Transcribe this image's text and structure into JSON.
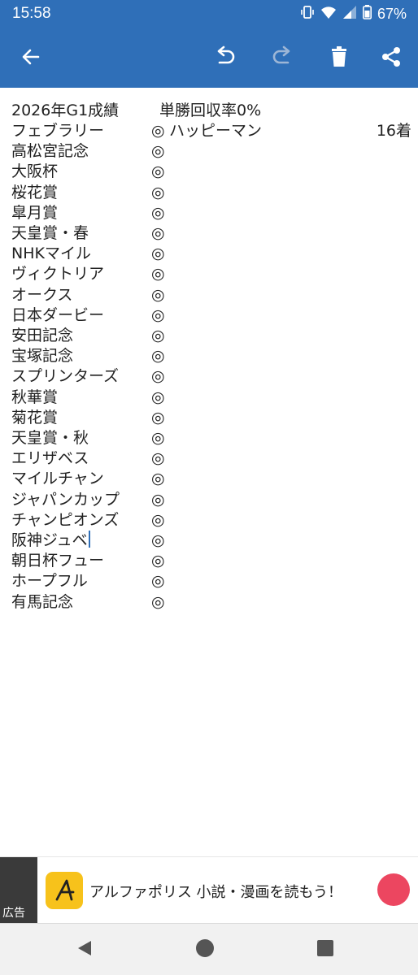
{
  "status_bar": {
    "time": "15:58",
    "battery": "67%"
  },
  "toolbar": {
    "icons": [
      "back-arrow-icon",
      "undo-icon",
      "redo-icon",
      "trash-icon",
      "share-icon"
    ]
  },
  "note": {
    "header": {
      "label": "2026年G1成績",
      "return_rate": "単勝回収率0%"
    },
    "rows": [
      {
        "race": "フェブラリー",
        "mark": "◎",
        "horse": "ハッピーマン",
        "place": "16着"
      },
      {
        "race": "高松宮記念",
        "mark": "◎"
      },
      {
        "race": "大阪杯",
        "mark": "◎"
      },
      {
        "race": "桜花賞",
        "mark": "◎"
      },
      {
        "race": "皐月賞",
        "mark": "◎"
      },
      {
        "race": "天皇賞・春",
        "mark": "◎"
      },
      {
        "race": "NHKマイル",
        "mark": "◎"
      },
      {
        "race": "ヴィクトリア",
        "mark": "◎"
      },
      {
        "race": "オークス",
        "mark": "◎"
      },
      {
        "race": "日本ダービー",
        "mark": "◎"
      },
      {
        "race": "安田記念",
        "mark": "◎"
      },
      {
        "race": "宝塚記念",
        "mark": "◎"
      },
      {
        "race": "スプリンターズ",
        "mark": "◎"
      },
      {
        "race": "秋華賞",
        "mark": "◎"
      },
      {
        "race": "菊花賞",
        "mark": "◎"
      },
      {
        "race": "天皇賞・秋",
        "mark": "◎"
      },
      {
        "race": "エリザベス",
        "mark": "◎"
      },
      {
        "race": "マイルチャン",
        "mark": "◎"
      },
      {
        "race": "ジャパンカップ",
        "mark": "◎"
      },
      {
        "race": "チャンピオンズ",
        "mark": "◎"
      },
      {
        "race": "阪神ジュベ",
        "mark": "◎"
      },
      {
        "race": "朝日杯フュー",
        "mark": "◎"
      },
      {
        "race": "ホープフル",
        "mark": "◎"
      },
      {
        "race": "有馬記念",
        "mark": "◎"
      }
    ]
  },
  "ad": {
    "thumb_label": "広告",
    "text": "アルファポリス 小説・漫画を読もう！",
    "logo_letter": "A",
    "dot_color": "#ec4660"
  },
  "colors": {
    "app_bar": "#2f6fb8",
    "cursor": "#2f6fb8"
  }
}
